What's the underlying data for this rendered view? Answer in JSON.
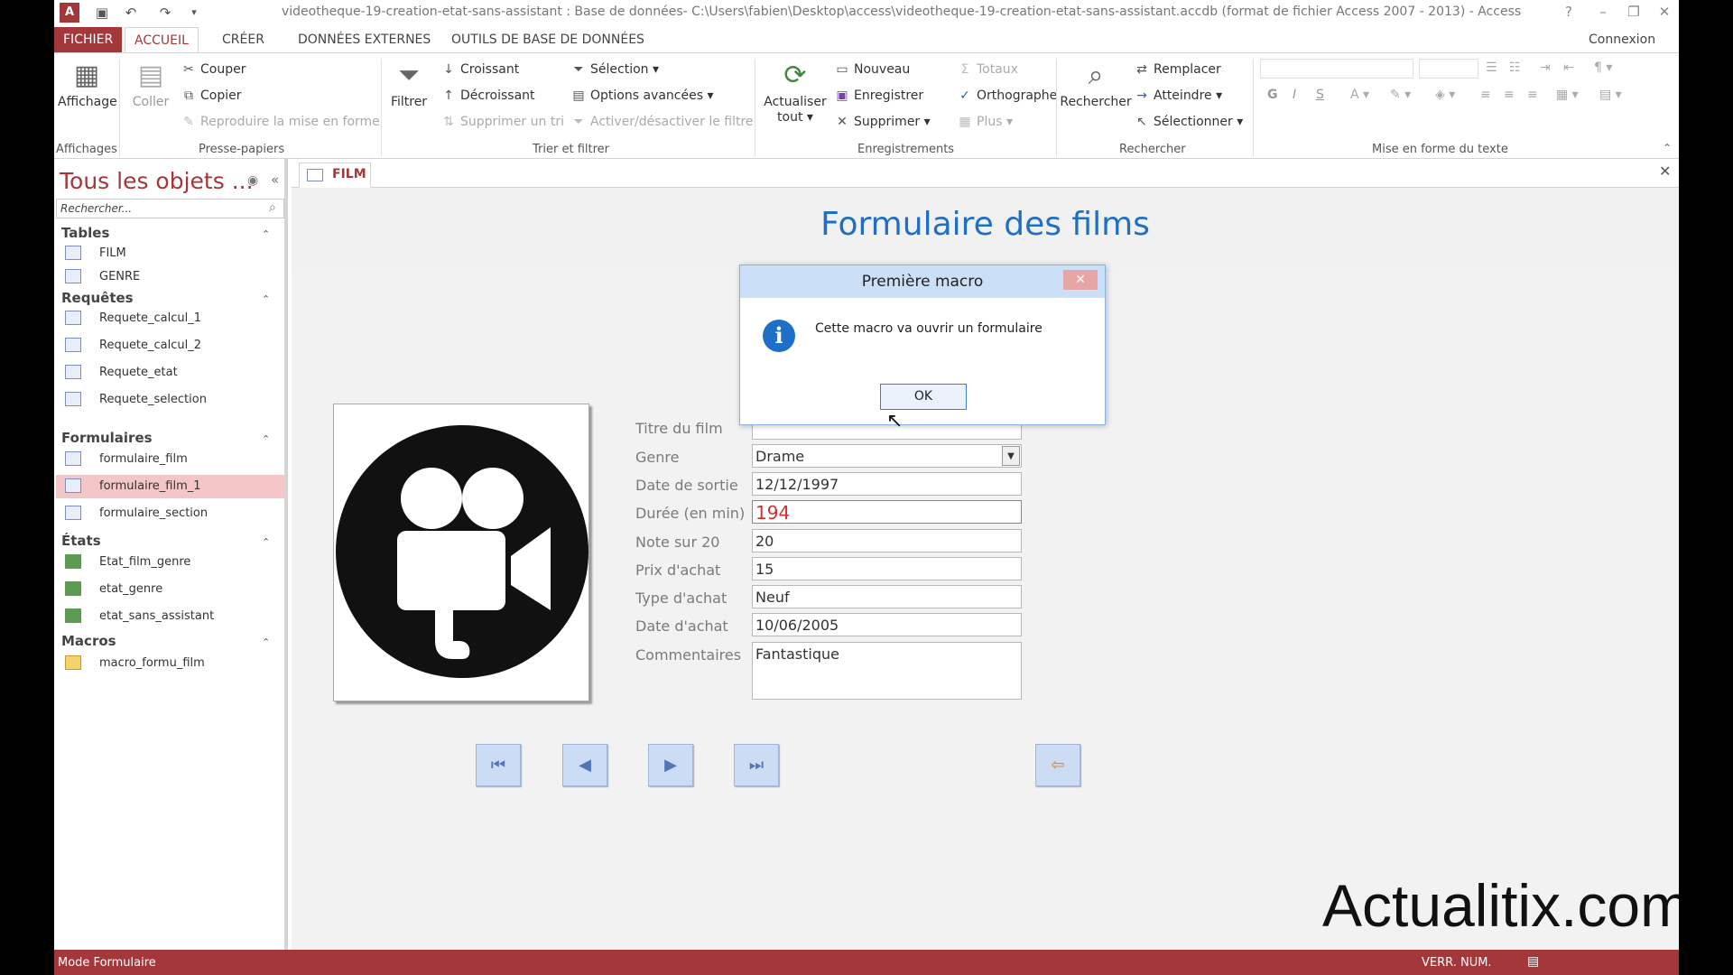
{
  "window": {
    "title": "videotheque-19-creation-etat-sans-assistant : Base de données- C:\\Users\\fabien\\Desktop\\access\\videotheque-19-creation-etat-sans-assistant.accdb (format de fichier Access 2007 - 2013) - Access",
    "account": "Connexion"
  },
  "ribbon_tabs": [
    "FICHIER",
    "ACCUEIL",
    "CRÉER",
    "DONNÉES EXTERNES",
    "OUTILS DE BASE DE DONNÉES"
  ],
  "ribbon": {
    "affichages": {
      "view": "Affichage",
      "label": "Affichages"
    },
    "presse_papiers": {
      "paste": "Coller",
      "cut": "Couper",
      "copy": "Copier",
      "format_painter": "Reproduire la mise en forme",
      "label": "Presse-papiers"
    },
    "trier_filtrer": {
      "filter": "Filtrer",
      "ascending": "Croissant",
      "descending": "Décroissant",
      "remove_sort": "Supprimer un tri",
      "selection": "Sélection",
      "advanced": "Options avancées",
      "toggle_filter": "Activer/désactiver le filtre",
      "label": "Trier et filtrer"
    },
    "enregistrements": {
      "refresh": "Actualiser",
      "refresh2": "tout",
      "new": "Nouveau",
      "save": "Enregistrer",
      "delete": "Supprimer",
      "totals": "Totaux",
      "spelling": "Orthographe",
      "more": "Plus",
      "label": "Enregistrements"
    },
    "rechercher": {
      "find": "Rechercher",
      "replace": "Remplacer",
      "goto": "Atteindre",
      "select": "Sélectionner",
      "label": "Rechercher"
    },
    "texte": {
      "bold": "G",
      "italic": "I",
      "underline": "S",
      "label": "Mise en forme du texte"
    }
  },
  "nav": {
    "title": "Tous les objets ...",
    "search_placeholder": "Rechercher...",
    "groups": [
      {
        "name": "Tables",
        "items": [
          "FILM",
          "GENRE"
        ]
      },
      {
        "name": "Requêtes",
        "items": [
          "Requete_calcul_1",
          "Requete_calcul_2",
          "Requete_etat",
          "Requete_selection"
        ]
      },
      {
        "name": "Formulaires",
        "items": [
          "formulaire_film",
          "formulaire_film_1",
          "formulaire_section"
        ]
      },
      {
        "name": "États",
        "items": [
          "Etat_film_genre",
          "etat_genre",
          "etat_sans_assistant"
        ]
      },
      {
        "name": "Macros",
        "items": [
          "macro_formu_film"
        ]
      }
    ],
    "selected": "formulaire_film_1"
  },
  "doc_tab": "FILM",
  "form": {
    "title": "Formulaire des films",
    "labels": {
      "titre": "Titre du film",
      "genre": "Genre",
      "date_sortie": "Date de sortie",
      "duree": "Durée (en min)",
      "note": "Note sur 20",
      "prix": "Prix d'achat",
      "type": "Type d'achat",
      "date_achat": "Date d'achat",
      "commentaires": "Commentaires"
    },
    "values": {
      "titre": "",
      "genre": "Drame",
      "date_sortie": "12/12/1997",
      "duree": "194",
      "note": "20",
      "prix": "15",
      "type": "Neuf",
      "date_achat": "10/06/2005",
      "commentaires": "Fantastique"
    }
  },
  "dialog": {
    "title": "Première macro",
    "message": "Cette macro va ouvrir un formulaire",
    "ok": "OK"
  },
  "status": {
    "mode": "Mode Formulaire",
    "num": "VERR. NUM."
  },
  "watermark": "Actualitix.com",
  "colors": {
    "accent": "#a4373a",
    "form_title": "#1f6fc5",
    "selected_item": "#f4c6c7",
    "nav_button": "#cbdcf4"
  }
}
